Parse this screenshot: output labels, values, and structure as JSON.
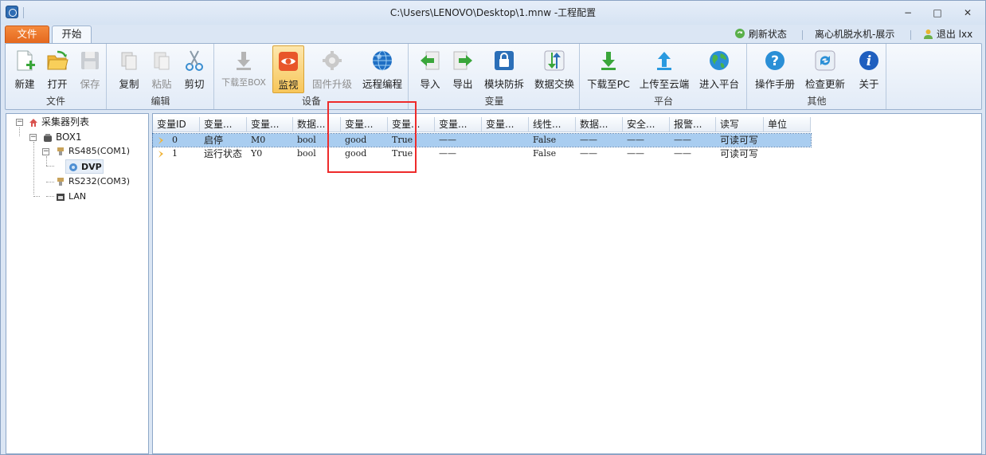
{
  "window": {
    "title": "C:\\Users\\LENOVO\\Desktop\\1.mnw -工程配置",
    "minimize": "−",
    "maximize": "□",
    "close": "✕"
  },
  "tabs": {
    "file": "文件",
    "start": "开始"
  },
  "topright": {
    "refresh": "刷新状态",
    "project": "离心机脱水机-展示",
    "logout": "退出 lxx"
  },
  "ribbon": {
    "file": {
      "label": "文件",
      "new": "新建",
      "open": "打开",
      "save": "保存"
    },
    "edit": {
      "label": "编辑",
      "copy": "复制",
      "paste": "粘贴",
      "cut": "剪切"
    },
    "device": {
      "label": "设备",
      "download_box": "下载至BOX",
      "monitor": "监视",
      "firmware": "固件升级",
      "remote": "远程编程"
    },
    "variable": {
      "label": "变量",
      "import": "导入",
      "export": "导出",
      "module_protect": "模块防拆",
      "data_exchange": "数据交换"
    },
    "platform": {
      "label": "平台",
      "download_pc": "下载至PC",
      "upload_cloud": "上传至云端",
      "enter_platform": "进入平台"
    },
    "other": {
      "label": "其他",
      "manual": "操作手册",
      "check_update": "检查更新",
      "about": "关于"
    }
  },
  "tree": {
    "root": "采集器列表",
    "box": "BOX1",
    "rs485": "RS485(COM1)",
    "dvp": "DVP",
    "rs232": "RS232(COM3)",
    "lan": "LAN"
  },
  "grid": {
    "headers": [
      "变量ID",
      "变量...",
      "变量...",
      "数据...",
      "变量...",
      "变量...",
      "变量...",
      "变量...",
      "线性...",
      "数据...",
      "安全...",
      "报警...",
      "读写",
      "单位"
    ],
    "rows": [
      {
        "id": "0",
        "name": "启停",
        "addr": "M0",
        "type": "bool",
        "quality": "good",
        "value": "True",
        "c7": "——",
        "c8": "",
        "linear": "False",
        "c10": "——",
        "c11": "——",
        "c12": "——",
        "rw": "可读可写",
        "unit": ""
      },
      {
        "id": "1",
        "name": "运行状态",
        "addr": "Y0",
        "type": "bool",
        "quality": "good",
        "value": "True",
        "c7": "——",
        "c8": "",
        "linear": "False",
        "c10": "——",
        "c11": "——",
        "c12": "——",
        "rw": "可读可写",
        "unit": ""
      }
    ]
  },
  "colors": {
    "accent_orange": "#e4681e",
    "highlight_box": "#ee2b2b",
    "selection": "#a9cdf0"
  }
}
